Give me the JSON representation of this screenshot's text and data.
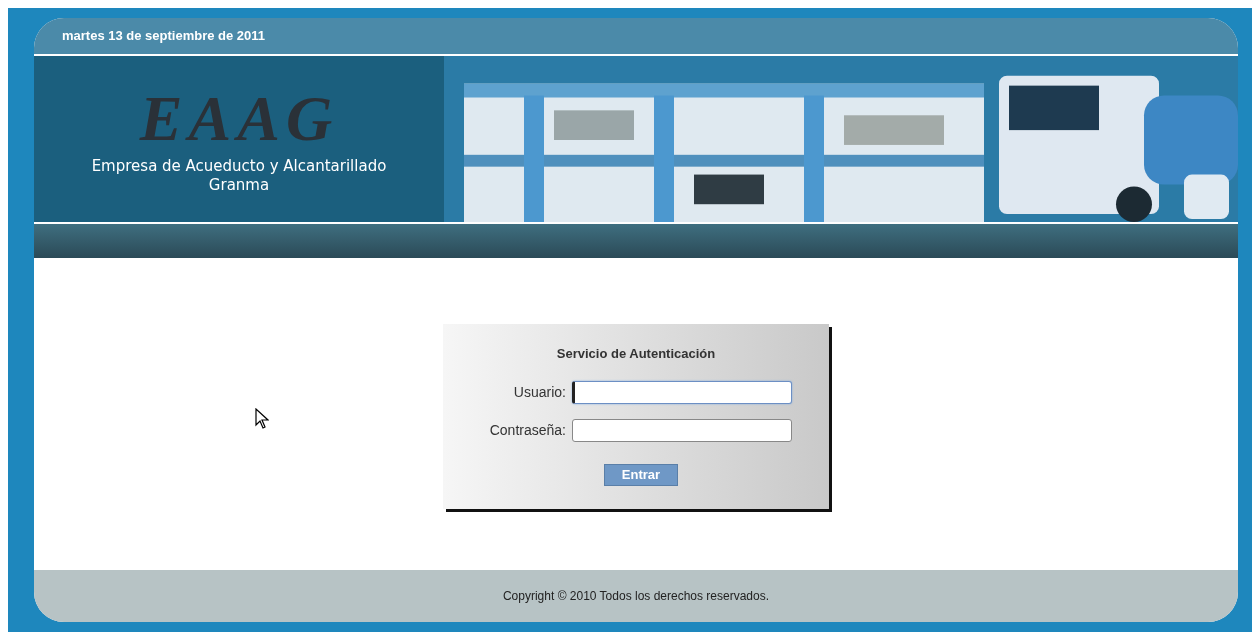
{
  "header": {
    "date": "martes 13 de septiembre de 2011"
  },
  "banner": {
    "logo": "EAAG",
    "subtitle_lines": [
      "Empresa de Acueducto y Alcantarillado",
      "Granma"
    ]
  },
  "login": {
    "title": "Servicio de Autenticación",
    "fields": [
      {
        "label": "Usuario:",
        "focused": true
      },
      {
        "label": "Contraseña:",
        "focused": false
      }
    ],
    "button": "Entrar"
  },
  "footer": {
    "text": "Copyright © 2010 Todos los derechos reservados."
  }
}
